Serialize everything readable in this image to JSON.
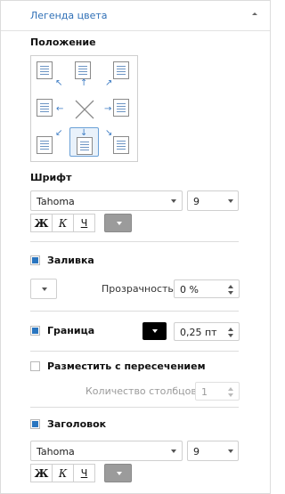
{
  "header": {
    "title": "Легенда цвета"
  },
  "position": {
    "title": "Положение"
  },
  "font": {
    "title": "Шрифт",
    "family": "Tahoma",
    "size": "9",
    "bold": "Ж",
    "italic": "К",
    "underline": "Ч"
  },
  "fill": {
    "label": "Заливка",
    "checked": true,
    "transparency_label": "Прозрачность:",
    "transparency_value": "0 %"
  },
  "border": {
    "label": "Граница",
    "checked": true,
    "color": "#000000",
    "width_value": "0,25 пт"
  },
  "intersect": {
    "label": "Разместить с пересечением",
    "checked": false,
    "columns_label": "Количество столбцов:",
    "columns_value": "1"
  },
  "heading": {
    "label": "Заголовок",
    "checked": true,
    "family": "Tahoma",
    "size": "9",
    "bold": "Ж",
    "italic": "К",
    "underline": "Ч"
  },
  "colors": {
    "accent": "#2a76c0",
    "font_color": "#9b9b9b"
  }
}
